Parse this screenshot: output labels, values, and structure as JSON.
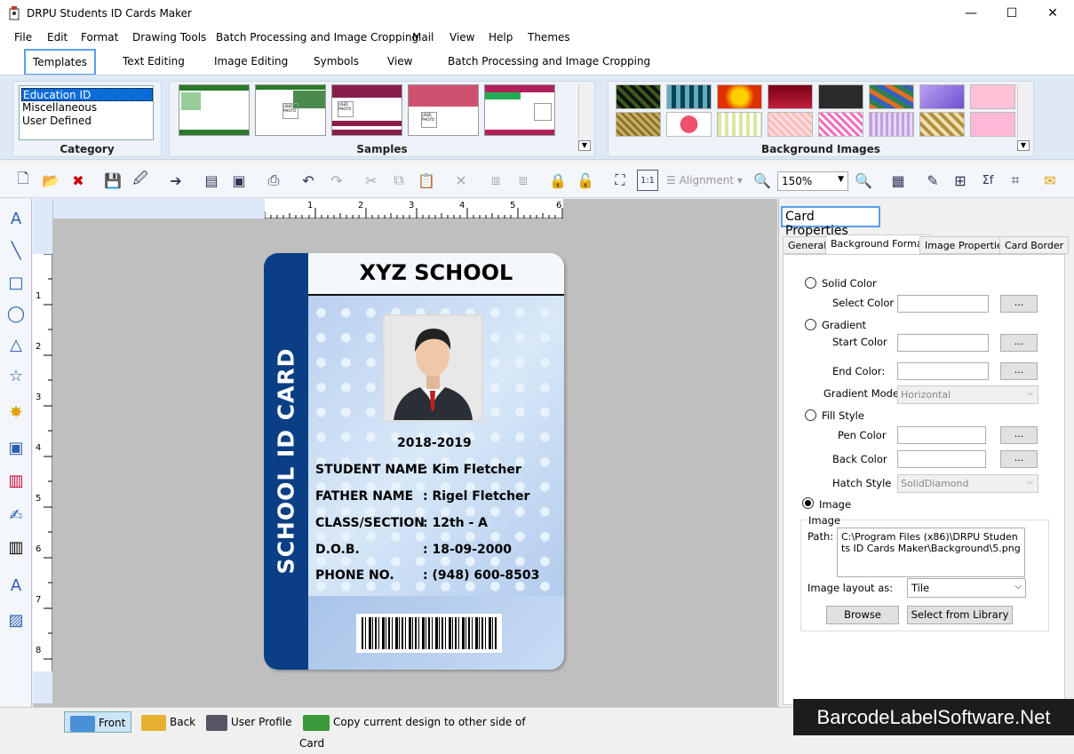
{
  "window": {
    "title": "DRPU Students ID Cards Maker",
    "min": "—",
    "max": "☐",
    "close": "✕"
  },
  "menu": [
    "File",
    "Edit",
    "Format",
    "Drawing Tools",
    "Batch Processing and Image Cropping",
    "Mail",
    "View",
    "Help",
    "Themes"
  ],
  "ribbon_tabs": [
    "Templates",
    "Text Editing",
    "Image Editing",
    "Symbols",
    "View",
    "Batch Processing and Image Cropping"
  ],
  "ribbon": {
    "category_label": "Category",
    "category_items": [
      "Education ID",
      "Miscellaneous",
      "User Defined"
    ],
    "samples_label": "Samples",
    "background_label": "Background Images"
  },
  "toolbar": {
    "alignment_label": "Alignment",
    "zoom_value": "150%"
  },
  "ruler": {
    "h": [
      "1",
      "2",
      "3",
      "4",
      "5",
      "6"
    ],
    "v": [
      "1",
      "2",
      "3",
      "4",
      "5",
      "6",
      "7",
      "8"
    ]
  },
  "card": {
    "side_text": "SCHOOL ID CARD",
    "school": "XYZ SCHOOL",
    "year": "2018-2019",
    "rows": [
      {
        "label": "STUDENT NAME",
        "value": ": Kim Fletcher"
      },
      {
        "label": "FATHER NAME",
        "value": ": Rigel Fletcher"
      },
      {
        "label": "CLASS/SECTION",
        "value": ": 12th - A"
      },
      {
        "label": "D.O.B.",
        "value": ": 18-09-2000"
      },
      {
        "label": "PHONE NO.",
        "value": ": (948) 600-8503"
      }
    ]
  },
  "properties": {
    "title": "Card Properties",
    "tabs": [
      "General",
      "Background Format",
      "Image Properties",
      "Card Border"
    ],
    "solid_color": "Solid Color",
    "select_color": "Select Color",
    "gradient": "Gradient",
    "start_color": "Start Color",
    "end_color": "End Color:",
    "gradient_mode": "Gradient Mode",
    "gradient_mode_value": "Horizontal",
    "fill_style": "Fill Style",
    "pen_color": "Pen Color",
    "back_color": "Back Color",
    "hatch_style": "Hatch Style",
    "hatch_style_value": "SolidDiamond",
    "image": "Image",
    "image_group": "Image",
    "path_label": "Path:",
    "path_value": "C:\\Program Files (x86)\\DRPU Students ID Cards Maker\\Background\\5.png",
    "layout_label": "Image layout as:",
    "layout_value": "Tile",
    "browse": "Browse",
    "select_library": "Select from Library",
    "dots": "..."
  },
  "status": {
    "front": "Front",
    "back": "Back",
    "user_profile": "User Profile",
    "copy": "Copy current design to other side of Card"
  },
  "watermark": "BarcodeLabelSoftware.Net"
}
